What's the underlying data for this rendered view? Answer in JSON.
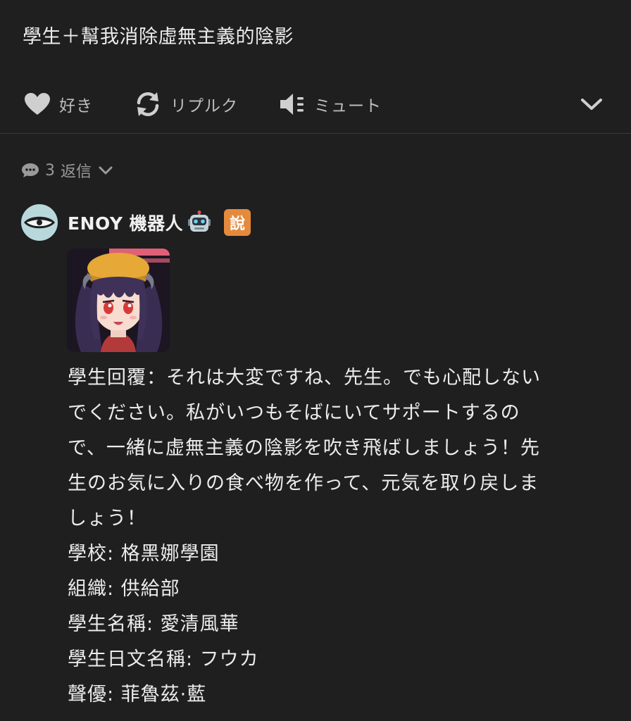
{
  "post": {
    "text": "學生＋幫我消除虛無主義的陰影"
  },
  "actions": {
    "like": {
      "label": "好き",
      "icon": "heart-icon"
    },
    "reblog": {
      "label": "リプルク",
      "icon": "reblog-icon"
    },
    "mute": {
      "label": "ミュート",
      "icon": "speaker-mute-icon"
    },
    "more": {
      "icon": "chevron-down-icon"
    }
  },
  "replies": {
    "count": "3",
    "label": "返信",
    "icon": "speech-bubble-icon"
  },
  "comment": {
    "username": "ENOY 機器人",
    "username_emoji": "robot-emoji",
    "badge": "說",
    "badge_color": "#e58a3c",
    "image": "anime-character-portrait",
    "lines": [
      "學生回覆：それは大変ですね、先生。でも心配しない",
      "でください。私がいつもそばにいてサポートするの",
      "で、一緒に虚無主義の陰影を吹き飛ばしましょう！先",
      "生のお気に入りの食べ物を作って、元気を取り戻しま",
      "しょう！",
      "學校: 格黑娜學園",
      "組織: 供給部",
      "學生名稱: 愛清風華",
      "學生日文名稱: フウカ",
      "聲優: 菲魯茲·藍"
    ]
  },
  "colors": {
    "background": "#1f1f1f",
    "text": "#ececec",
    "muted": "#bdbdbd",
    "divider": "#3a3a3a"
  }
}
